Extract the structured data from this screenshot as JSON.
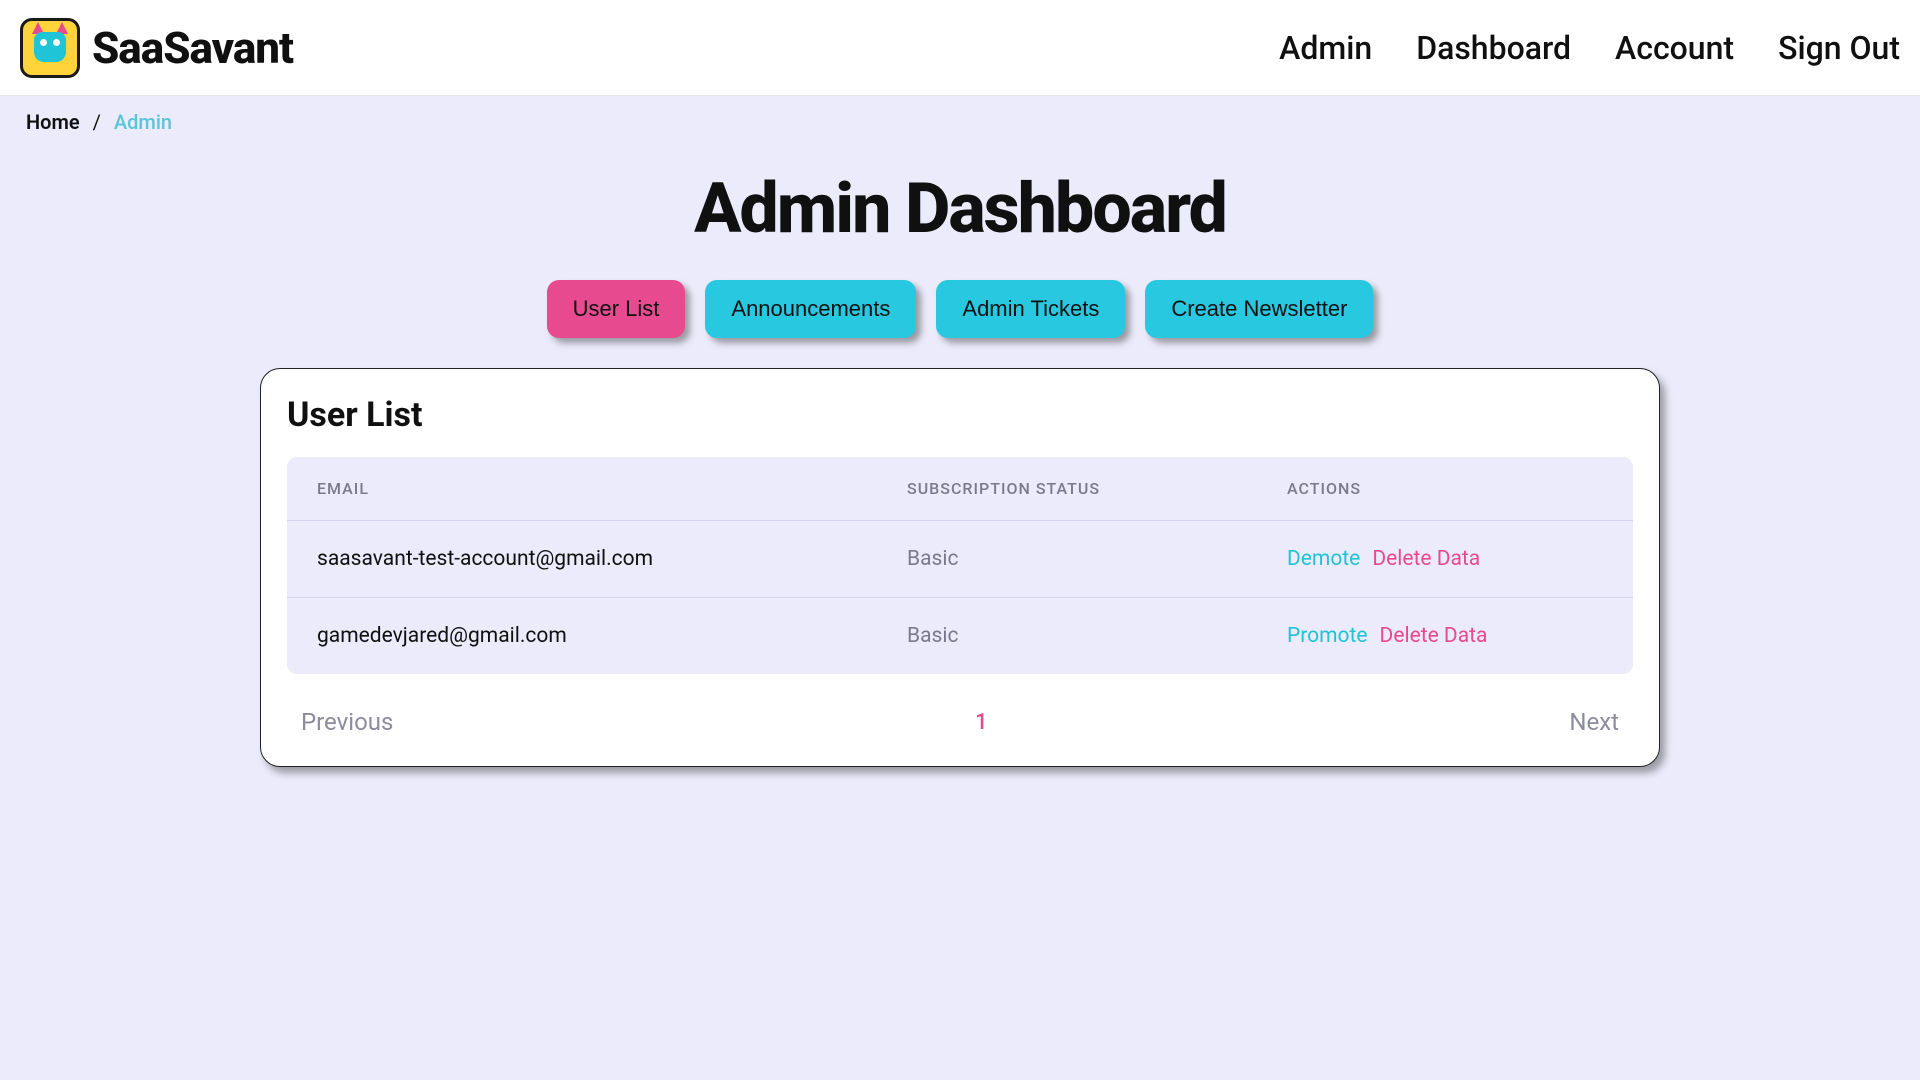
{
  "brand": {
    "name": "SaaSavant"
  },
  "nav": {
    "admin": "Admin",
    "dashboard": "Dashboard",
    "account": "Account",
    "signout": "Sign Out"
  },
  "breadcrumb": {
    "home": "Home",
    "sep": "/",
    "current": "Admin"
  },
  "page": {
    "title": "Admin Dashboard"
  },
  "tabs": {
    "user_list": "User List",
    "announcements": "Announcements",
    "admin_tickets": "Admin Tickets",
    "create_newsletter": "Create Newsletter"
  },
  "card": {
    "title": "User List"
  },
  "table": {
    "headers": {
      "email": "EMAIL",
      "status": "SUBSCRIPTION STATUS",
      "actions": "ACTIONS"
    },
    "rows": [
      {
        "email": "saasavant-test-account@gmail.com",
        "status": "Basic",
        "action1": "Demote",
        "action2": "Delete Data"
      },
      {
        "email": "gamedevjared@gmail.com",
        "status": "Basic",
        "action1": "Promote",
        "action2": "Delete Data"
      }
    ]
  },
  "pagination": {
    "prev": "Previous",
    "page": "1",
    "next": "Next"
  }
}
